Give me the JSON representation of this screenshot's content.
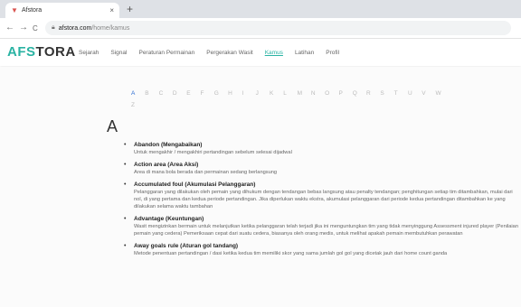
{
  "browser": {
    "tab_title": "Afstora",
    "tab_close": "×",
    "new_tab": "+",
    "back": "←",
    "forward": "→",
    "reload": "C",
    "url_host": "afstora.com",
    "url_path": "/home/kamus"
  },
  "site": {
    "logo_part1": "AFS",
    "logo_part2": "TORA",
    "menu": [
      "Sejarah",
      "Signal",
      "Peraturan Permainan",
      "Pergerakan Wasit",
      "Kamus",
      "Latihan",
      "Profil"
    ],
    "active_menu": "Kamus"
  },
  "alphabet": {
    "row1": [
      "A",
      "B",
      "C",
      "D",
      "E",
      "F",
      "G",
      "H",
      "I",
      "J",
      "K",
      "L",
      "M",
      "N",
      "O",
      "P",
      "Q",
      "R",
      "S",
      "T",
      "U",
      "V",
      "W"
    ],
    "row2": "Z",
    "selected": "A"
  },
  "section_letter": "A",
  "entries": [
    {
      "term": "Abandon (Mengabaikan)",
      "def": "Untuk mengakhir / mengakhiri pertandingan sebelum selesai dijadwal"
    },
    {
      "term": "Action area (Area Aksi)",
      "def": "Area di mana bola berada dan permainan sedang berlangsung"
    },
    {
      "term": "Accumulated foul (Akumulasi Pelanggaran)",
      "def": "Pelanggaran yang dilakukan oleh pemain yang dihukum dengan tendangan bebas langsung atau penalty tendangan; penghitungan setiap tim ditambahkan, mulai dari nol, di yang pertama dan kedua periode pertandingan. Jika diperlukan waktu ekstra, akumulasi pelanggaran dari periode kedua pertandingan ditambahkan ke yang dilakukan selama waktu tambahan"
    },
    {
      "term": "Advantage (Keuntungan)",
      "def": "Wasit mengizinkan bermain untuk melanjutkan ketika pelanggaran telah terjadi jika ini menguntungkan tim yang tidak menyinggung Assessment injured player (Penilaian pemain yang cedera) Pemeriksaan cepat dari suatu cedera, biasanya oleh orang medis, untuk melihat apakah pemain membutuhkan perawatan"
    },
    {
      "term": "Away goals rule (Aturan gol tandang)",
      "def": "Metode penentuan pertandingan / dasi ketika kedua tim memiliki skor yang sama jumlah gol gol yang dicetak jauh dari home count ganda"
    }
  ]
}
